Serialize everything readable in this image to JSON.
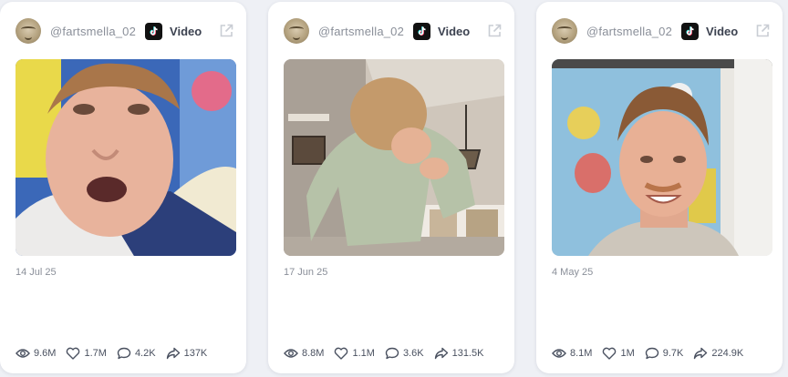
{
  "colors": {
    "page_background": "#eef0f5",
    "card_background": "#ffffff",
    "muted_text": "#8a8f99",
    "icon_stroke": "#4a5160"
  },
  "posts": [
    {
      "username": "@fartsmella_02",
      "platform_icon": "tiktok-icon",
      "type_label": "Video",
      "date": "14 Jul 25",
      "stats": {
        "views": "9.6M",
        "likes": "1.7M",
        "comments": "4.2K",
        "shares": "137K"
      }
    },
    {
      "username": "@fartsmella_02",
      "platform_icon": "tiktok-icon",
      "type_label": "Video",
      "date": "17 Jun 25",
      "stats": {
        "views": "8.8M",
        "likes": "1.1M",
        "comments": "3.6K",
        "shares": "131.5K"
      }
    },
    {
      "username": "@fartsmella_02",
      "platform_icon": "tiktok-icon",
      "type_label": "Video",
      "date": "4 May 25",
      "stats": {
        "views": "8.1M",
        "likes": "1M",
        "comments": "9.7K",
        "shares": "224.9K"
      }
    }
  ]
}
